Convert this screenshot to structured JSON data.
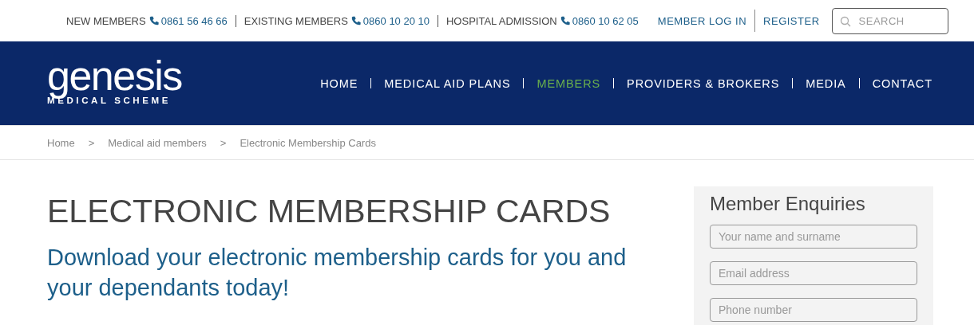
{
  "contacts": [
    {
      "label": "NEW MEMBERS",
      "phone": "0861 56 46 66"
    },
    {
      "label": "EXISTING MEMBERS",
      "phone": "0860 10 20 10"
    },
    {
      "label": "HOSPITAL ADMISSION",
      "phone": "0860 10 62 05"
    }
  ],
  "account_links": [
    "MEMBER LOG IN",
    "REGISTER"
  ],
  "search": {
    "placeholder": "SEARCH"
  },
  "logo": {
    "name": "genesis",
    "tagline": "MEDICAL SCHEME"
  },
  "nav": [
    {
      "label": "HOME",
      "selected": false
    },
    {
      "label": "MEDICAL AID PLANS",
      "selected": false
    },
    {
      "label": "MEMBERS",
      "selected": true
    },
    {
      "label": "PROVIDERS & BROKERS",
      "selected": false
    },
    {
      "label": "MEDIA",
      "selected": false
    },
    {
      "label": "CONTACT",
      "selected": false
    }
  ],
  "breadcrumb": [
    {
      "label": "Home",
      "kind": "link"
    },
    {
      "label": ">",
      "kind": "separator"
    },
    {
      "label": "Medical aid members",
      "kind": "link"
    },
    {
      "label": ">",
      "kind": "separator"
    },
    {
      "label": "Electronic Membership Cards",
      "kind": "current"
    }
  ],
  "page": {
    "title": "ELECTRONIC MEMBERSHIP CARDS",
    "subtitle": "Download your electronic membership cards for you and your dependants today!"
  },
  "enquiries": {
    "title": "Member Enquiries",
    "fields": [
      {
        "placeholder": "Your name and surname"
      },
      {
        "placeholder": "Email address"
      },
      {
        "placeholder": "Phone number"
      }
    ]
  }
}
